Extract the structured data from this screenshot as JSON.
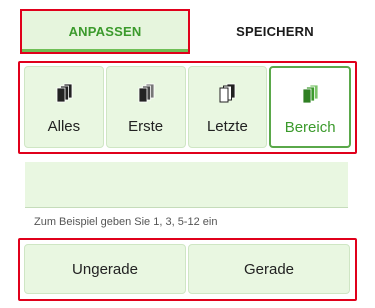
{
  "tabs": {
    "customize_label": "ANPASSEN",
    "save_label": "SPEICHERN"
  },
  "page_selection": {
    "items": [
      {
        "label": "Alles",
        "icon": "all-pages-icon",
        "selected": false
      },
      {
        "label": "Erste",
        "icon": "first-pages-icon",
        "selected": false
      },
      {
        "label": "Letzte",
        "icon": "last-pages-icon",
        "selected": false
      },
      {
        "label": "Bereich",
        "icon": "range-pages-icon",
        "selected": true
      }
    ]
  },
  "range": {
    "value": "",
    "hint": "Zum Beispiel geben Sie 1, 3, 5-12 ein"
  },
  "parity": {
    "odd_label": "Ungerade",
    "even_label": "Gerade"
  },
  "colors": {
    "accent_green": "#3b9a2c",
    "button_bg": "#e9f7e1",
    "highlight_red": "#e0001b"
  }
}
